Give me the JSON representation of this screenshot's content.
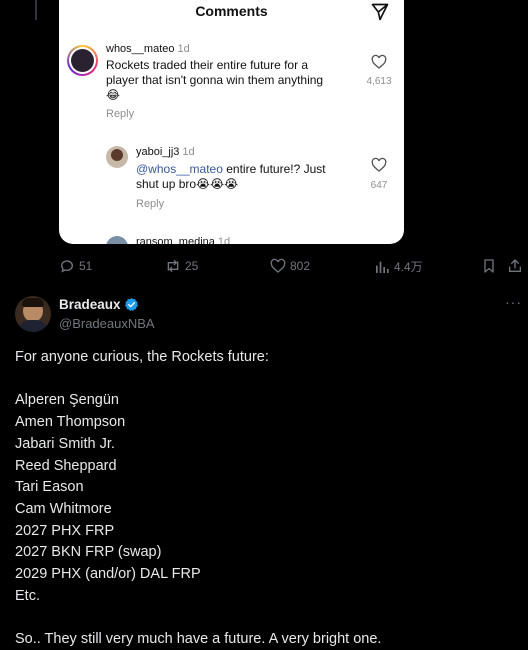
{
  "embed": {
    "title": "Comments",
    "comments": [
      {
        "user": "whos__mateo",
        "ago": "1d",
        "text_lines": [
          "Rockets traded their entire future for a",
          "player that isn't gonna win them anything"
        ],
        "emoji": "😂",
        "likes": "4,613",
        "reply": "Reply"
      },
      {
        "user": "yaboi_jj3",
        "ago": "1d",
        "mention": "@whos__mateo",
        "text_line1": " entire future!? Just",
        "text_line2": "shut up bro😭😭😭",
        "likes": "647",
        "reply": "Reply"
      },
      {
        "user": "ransom_medina",
        "ago": "1d"
      }
    ]
  },
  "actions": {
    "replies": "51",
    "reposts": "25",
    "likes": "802",
    "views": "4.4万"
  },
  "tweet": {
    "name": "Bradeaux",
    "handle": "@BradeauxNBA",
    "more": "···",
    "intro": "For anyone curious, the Rockets future:",
    "list": [
      "Alperen Şengün",
      "Amen Thompson",
      "Jabari Smith Jr.",
      "Reed Sheppard",
      "Tari Eason",
      "Cam Whitmore",
      "2027 PHX FRP",
      "2027 BKN FRP (swap)",
      "2029 PHX (and/or) DAL FRP",
      "Etc."
    ],
    "closing": "So.. They still very much have a future. A very bright one."
  },
  "colors": {
    "background": "#000000",
    "text": "#e7e9ea",
    "muted": "#71767b",
    "verified": "#1d9bf0",
    "mention": "#385898"
  }
}
